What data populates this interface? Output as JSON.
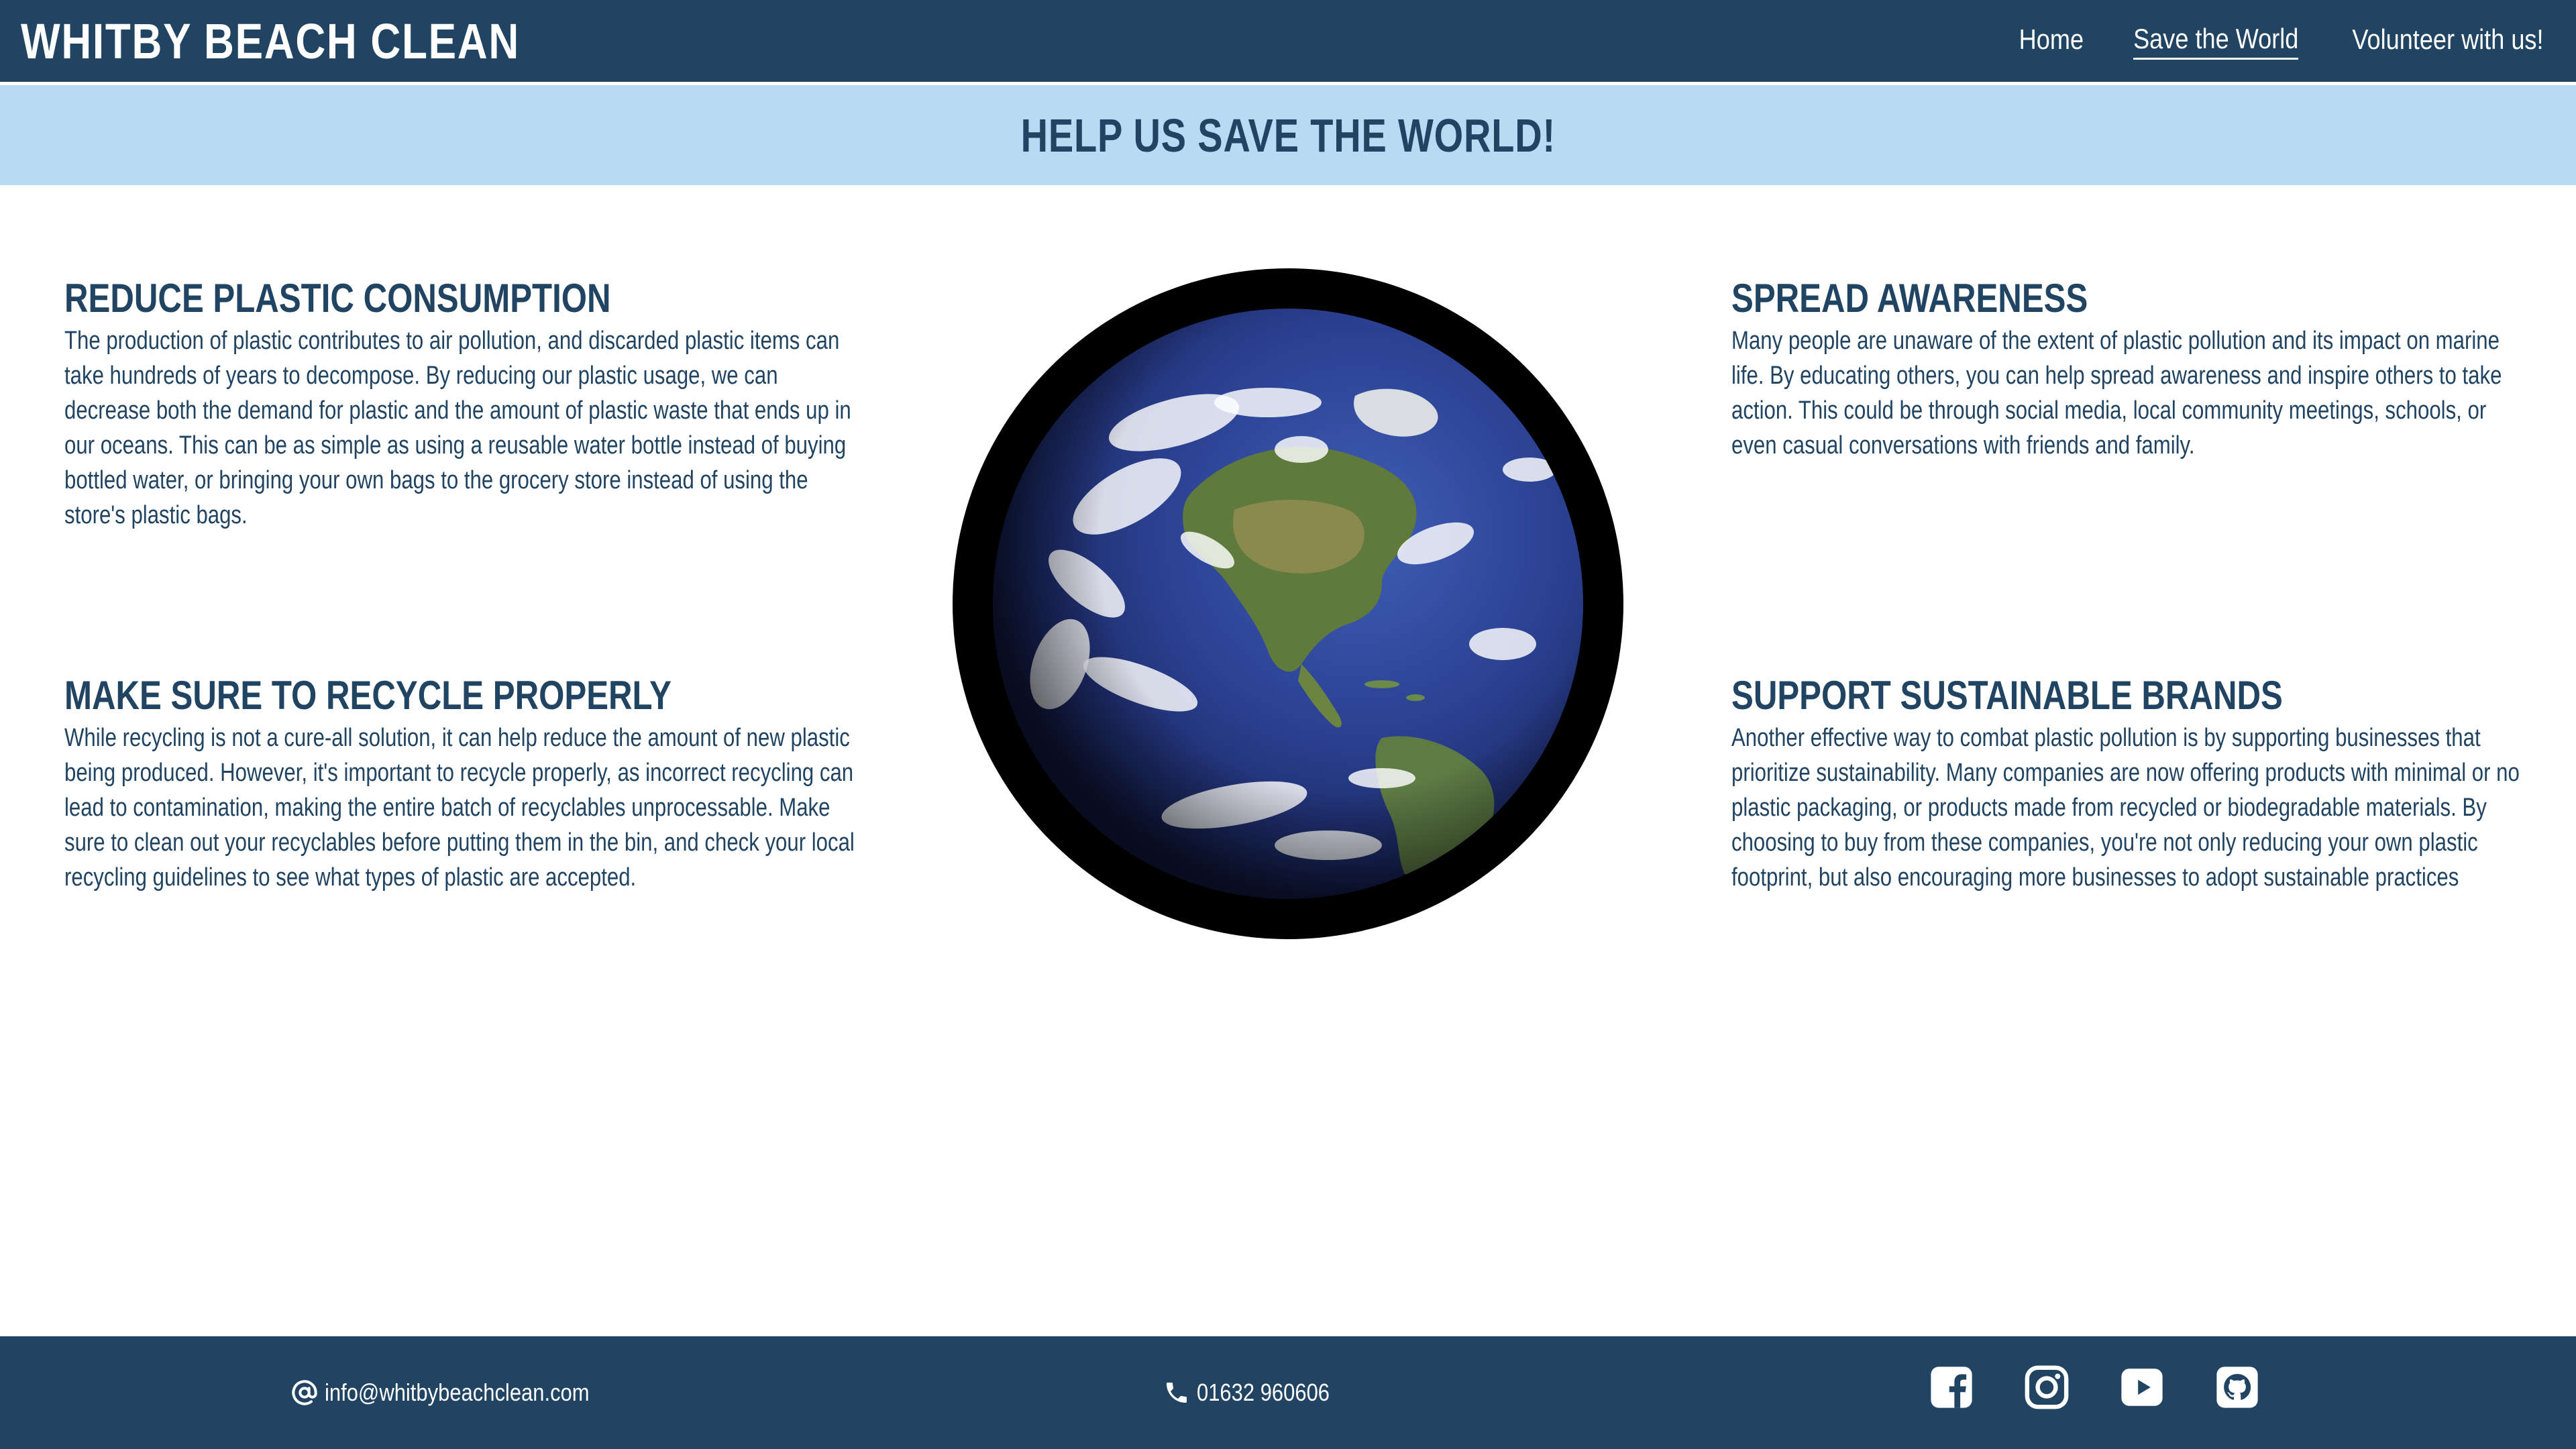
{
  "header": {
    "site_title": "WHITBY BEACH CLEAN",
    "nav": [
      {
        "label": "Home"
      },
      {
        "label": "Save the World"
      },
      {
        "label": "Volunteer with us!"
      }
    ],
    "active_nav": "Save the World"
  },
  "hero": {
    "title": "HELP US SAVE THE WORLD!"
  },
  "sections": [
    {
      "heading": "REDUCE PLASTIC CONSUMPTION",
      "body": "The production of plastic contributes to air pollution, and discarded plastic items can take hundreds of years to decompose. By reducing our plastic usage, we can decrease both the demand for plastic and the amount of plastic waste that ends up in our oceans. This can be as simple as using a reusable water bottle instead of buying bottled water, or bringing your own bags to the grocery store instead of using the store's plastic bags."
    },
    {
      "heading": "SPREAD AWARENESS",
      "body": "Many people are unaware of the extent of plastic pollution and its impact on marine life. By educating others, you can help spread awareness and inspire others to take action. This could be through social media, local community meetings, schools, or even casual conversations with friends and family."
    },
    {
      "heading": "MAKE SURE TO RECYCLE PROPERLY",
      "body": "While recycling is not a cure-all solution, it can help reduce the amount of new plastic being produced. However, it's important to recycle properly, as incorrect recycling can lead to contamination, making the entire batch of recyclables unprocessable. Make sure to clean out your recyclables before putting them in the bin, and check your local recycling guidelines to see what types of plastic are accepted."
    },
    {
      "heading": "SUPPORT SUSTAINABLE BRANDS",
      "body": "Another effective way to combat plastic pollution is by supporting businesses that prioritize sustainability. Many companies are now offering products with minimal or no plastic packaging, or products made from recycled or biodegradable materials. By choosing to buy from these companies, you're not only reducing your own plastic footprint, but also encouraging more businesses to adopt sustainable practices"
    }
  ],
  "image": {
    "icon": "earth-globe-image"
  },
  "footer": {
    "email": "info@whitbybeachclean.com",
    "phone": "01632 960606",
    "socials": [
      "facebook-icon",
      "instagram-icon",
      "youtube-icon",
      "github-icon"
    ]
  },
  "colors": {
    "navy": "#204462",
    "banner": "#b7dbf3",
    "white": "#ffffff"
  }
}
